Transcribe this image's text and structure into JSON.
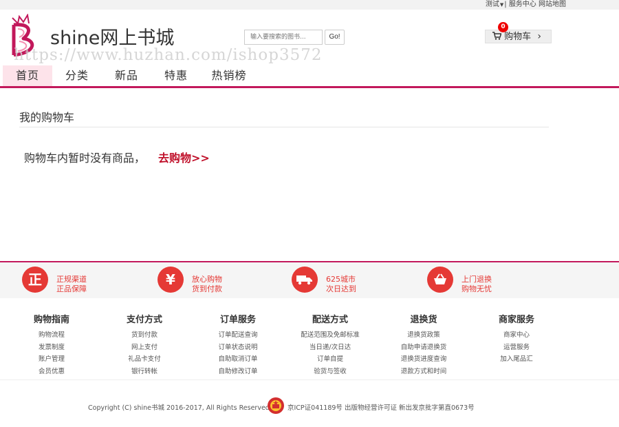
{
  "topbar": {
    "user": "测试",
    "service_center": "服务中心",
    "sitemap": "网站地图"
  },
  "header": {
    "site_name": "shine网上书城",
    "watermark": "https://www.huzhan.com/ishop3572",
    "search_placeholder": "输入要搜索的图书...",
    "search_button": "Go!",
    "cart_count": "0",
    "cart_label": "购物车"
  },
  "nav": {
    "items": [
      "首页",
      "分类",
      "新品",
      "特惠",
      "热销榜"
    ]
  },
  "main": {
    "title": "我的购物车",
    "empty_message": "购物车内暂时没有商品，",
    "go_shopping": "去购物>>"
  },
  "features": [
    {
      "icon": "正",
      "line1": "正规渠道",
      "line2": "正品保障"
    },
    {
      "icon": "¥",
      "line1": "放心购物",
      "line2": "货到付款"
    },
    {
      "icon": "truck-icon",
      "line1": "625城市",
      "line2": "次日达到"
    },
    {
      "icon": "basket-icon",
      "line1": "上门退换",
      "line2": "购物无忧"
    }
  ],
  "footer_columns": [
    {
      "title": "购物指南",
      "links": [
        "购物流程",
        "发票制度",
        "账户管理",
        "会员优惠"
      ]
    },
    {
      "title": "支付方式",
      "links": [
        "货到付款",
        "网上支付",
        "礼品卡支付",
        "银行转帐"
      ]
    },
    {
      "title": "订单服务",
      "links": [
        "订单配送查询",
        "订单状态说明",
        "自助取消订单",
        "自助修改订单"
      ]
    },
    {
      "title": "配送方式",
      "links": [
        "配送范围及免邮标准",
        "当日递/次日达",
        "订单自提",
        "验货与签收"
      ]
    },
    {
      "title": "退换货",
      "links": [
        "退换货政策",
        "自助申请退换货",
        "退换货进度查询",
        "退款方式和时间"
      ]
    },
    {
      "title": "商家服务",
      "links": [
        "商家中心",
        "运营服务",
        "加入尾品汇"
      ]
    }
  ],
  "footer": {
    "copyright": "Copyright (C) shine书城 2016-2017, All Rights Reserved",
    "icp": "京ICP证041189号 出版物经营许可证 新出发京批字第直0673号"
  },
  "colors": {
    "brand": "#c2185b",
    "accent_red": "#e53935",
    "link_red": "#c0102a"
  }
}
